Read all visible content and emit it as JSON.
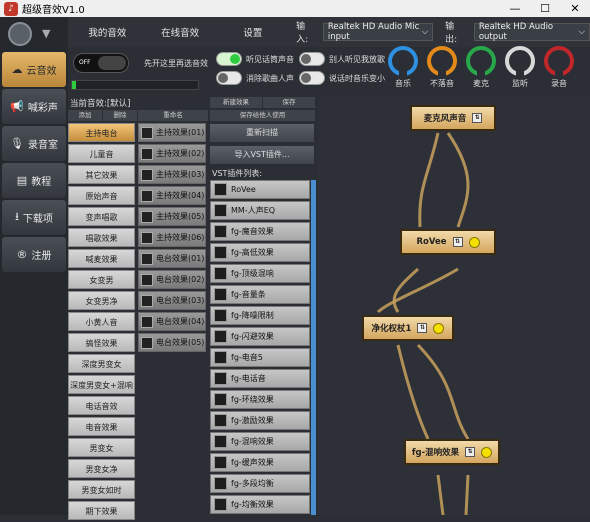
{
  "window": {
    "title": "超级音效V1.0",
    "minimize": "—",
    "maximize": "☐",
    "close": "✕"
  },
  "nav": {
    "items": [
      {
        "label": "云音效",
        "icon": "cloud-icon",
        "glyph": "☁"
      },
      {
        "label": "喊彩声",
        "icon": "horn-icon",
        "glyph": "📢"
      },
      {
        "label": "录音室",
        "icon": "mic-icon",
        "glyph": "🎙"
      },
      {
        "label": "教程",
        "icon": "book-icon",
        "glyph": "▤"
      },
      {
        "label": "下载项",
        "icon": "download-icon",
        "glyph": "⭳"
      },
      {
        "label": "注册",
        "icon": "register-icon",
        "glyph": "®"
      }
    ]
  },
  "tabs": {
    "my": "我的音效",
    "online": "在线音效",
    "settings": "设置"
  },
  "devices": {
    "input_label": "输入:",
    "input_value": "Realtek HD Audio Mic input",
    "output_label": "输出:",
    "output_value": "Realtek HD Audio output"
  },
  "controls": {
    "master_switch": "OFF",
    "master_hint": "先开这里再选音效",
    "t1": "听见话筒声音",
    "t2": "别人听见我放歌",
    "t3": "消除歌曲人声",
    "t4": "说话时音乐变小"
  },
  "dials": [
    {
      "label": "音乐",
      "color": "#2f8fe0"
    },
    {
      "label": "不落音",
      "color": "#e38a1a"
    },
    {
      "label": "麦克",
      "color": "#28a84a"
    },
    {
      "label": "监听",
      "color": "#d8d8d8"
    },
    {
      "label": "录音",
      "color": "#c0262a"
    }
  ],
  "presets": {
    "current_label": "当前音效:[默认]",
    "add": "添加",
    "remove": "删除",
    "rename": "重命名",
    "categories": [
      "主持电台",
      "儿童音",
      "其它效果",
      "原始声音",
      "变声唱歌",
      "唱歌效果",
      "喊麦效果",
      "女变男",
      "女变男净",
      "小黄人音",
      "搞怪效果",
      "深度男变女",
      "深度男变女+混响",
      "电话音效",
      "电音效果",
      "男变女",
      "男变女净",
      "男变女如时",
      "期下效果"
    ],
    "effects": [
      "主持效果(01)",
      "主持效果(02)",
      "主持效果(03)",
      "主持效果(04)",
      "主持效果(05)",
      "主持效果(06)",
      "电台效果(01)",
      "电台效果(02)",
      "电台效果(03)",
      "电台效果(04)",
      "电台效果(05)"
    ]
  },
  "vst": {
    "new": "新建效果",
    "save": "保存",
    "save_share": "保存给他人使用",
    "rescan": "重新扫描",
    "import": "导入VST插件...",
    "list_title": "VST插件列表:",
    "plugins": [
      "RoVee",
      "MM-人声EQ",
      "fg-魔音效果",
      "fg-高低效果",
      "fg-顶级混响",
      "fg-音量条",
      "fg-降噪限制",
      "fg-闪避效果",
      "fg-电音5",
      "fg-电话音",
      "fg-环绕效果",
      "fg-激励效果",
      "fg-混响效果",
      "fg-缓声效果",
      "fg-多段均衡",
      "fg-均衡效果"
    ]
  },
  "graph": {
    "nodes": [
      "麦克风声音",
      "RoVee",
      "净化权杖1",
      "fg-混响效果"
    ]
  }
}
